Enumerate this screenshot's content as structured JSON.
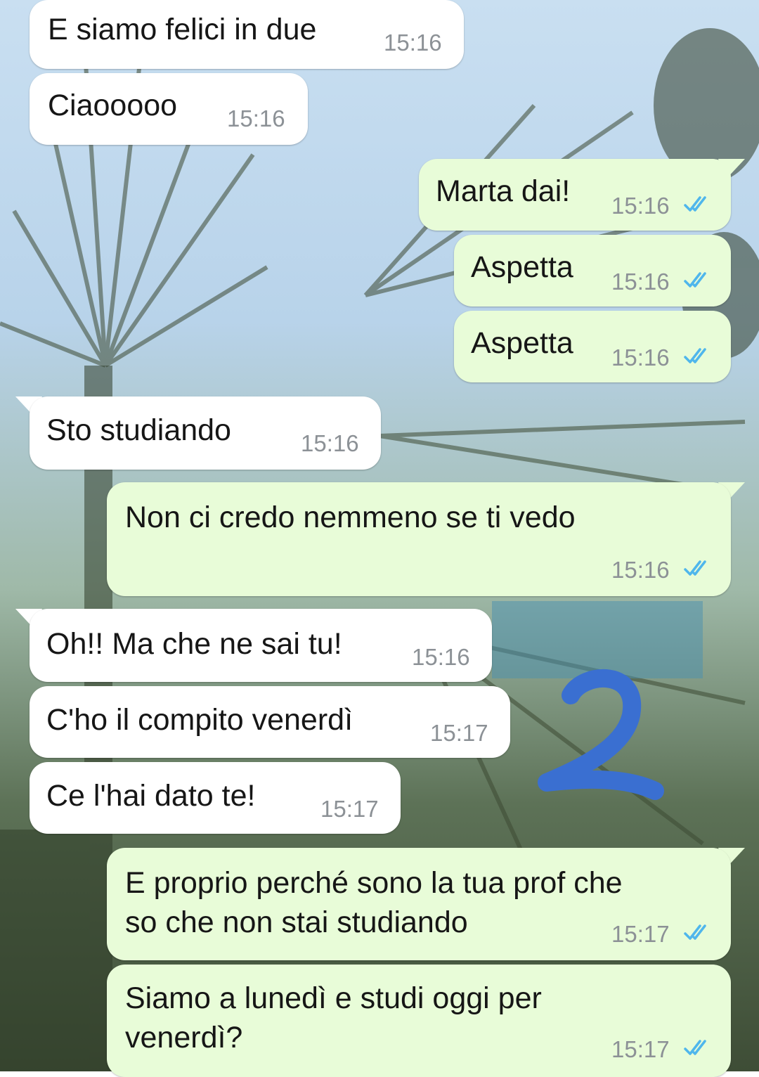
{
  "conversation": {
    "messages": [
      {
        "direction": "incoming",
        "text": "E siamo felici in due",
        "time": "15:16"
      },
      {
        "direction": "incoming",
        "text": "Ciaooooo",
        "time": "15:16"
      },
      {
        "direction": "outgoing",
        "text": "Marta dai!",
        "time": "15:16",
        "status": "read"
      },
      {
        "direction": "outgoing",
        "text": "Aspetta",
        "time": "15:16",
        "status": "read"
      },
      {
        "direction": "outgoing",
        "text": "Aspetta",
        "time": "15:16",
        "status": "read"
      },
      {
        "direction": "incoming",
        "text": "Sto studiando",
        "time": "15:16"
      },
      {
        "direction": "outgoing",
        "text": "Non ci credo nemmeno se ti vedo",
        "time": "15:16",
        "status": "read"
      },
      {
        "direction": "incoming",
        "text": "Oh!! Ma che ne sai tu!",
        "time": "15:16"
      },
      {
        "direction": "incoming",
        "text": "C'ho il compito venerdì",
        "time": "15:17"
      },
      {
        "direction": "incoming",
        "text": "Ce l'hai dato te!",
        "time": "15:17"
      },
      {
        "direction": "outgoing",
        "lines": [
          "E proprio perché sono la tua prof che",
          "so che non stai studiando"
        ],
        "time": "15:17",
        "status": "read"
      },
      {
        "direction": "outgoing",
        "lines": [
          "Siamo a lunedì e studi oggi per",
          "venerdì?"
        ],
        "time": "15:17",
        "status": "read"
      }
    ]
  },
  "annotation": {
    "label": "2",
    "color": "#3a6fd1"
  },
  "colors": {
    "incoming_bubble": "#ffffff",
    "outgoing_bubble": "#e8fcd8",
    "read_ticks": "#4fb6ec",
    "timestamp": "#8c9196"
  }
}
